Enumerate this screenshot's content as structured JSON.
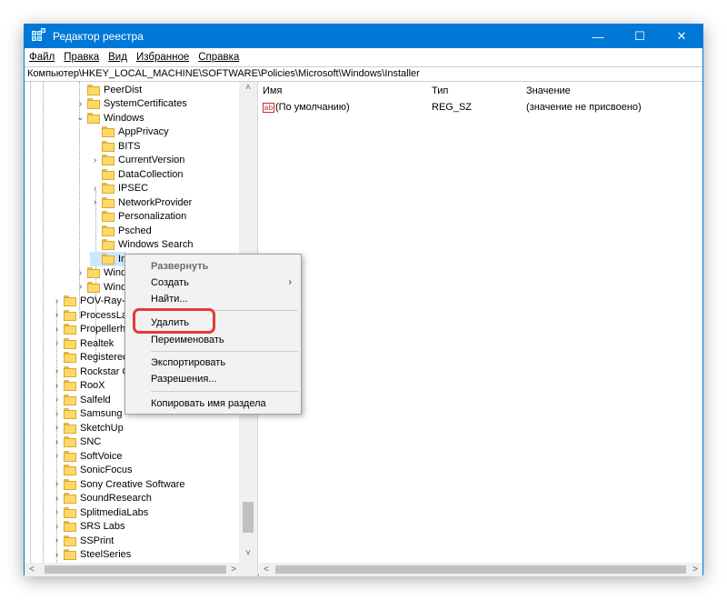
{
  "window": {
    "title": "Редактор реестра",
    "controls": [
      "—",
      "☐",
      "✕"
    ]
  },
  "menu": [
    "Файл",
    "Правка",
    "Вид",
    "Избранное",
    "Справка"
  ],
  "address": "Компьютер\\HKEY_LOCAL_MACHINE\\SOFTWARE\\Policies\\Microsoft\\Windows\\Installer",
  "tree": {
    "items": [
      {
        "label": "PeerDist",
        "exp": ""
      },
      {
        "label": "SystemCertificates",
        "exp": "›"
      },
      {
        "label": "Windows",
        "exp": "⌄"
      },
      {
        "label": "AppPrivacy",
        "exp": ""
      },
      {
        "label": "BITS",
        "exp": ""
      },
      {
        "label": "CurrentVersion",
        "exp": "›"
      },
      {
        "label": "DataCollection",
        "exp": ""
      },
      {
        "label": "IPSEC",
        "exp": "›"
      },
      {
        "label": "NetworkProvider",
        "exp": "›"
      },
      {
        "label": "Personalization",
        "exp": ""
      },
      {
        "label": "Psched",
        "exp": ""
      },
      {
        "label": "Windows Search",
        "exp": ""
      },
      {
        "label": "In",
        "exp": ""
      },
      {
        "label": "Wind",
        "exp": "›"
      },
      {
        "label": "Wind",
        "exp": "›"
      },
      {
        "label": "POV-Ray-F",
        "exp": "›"
      },
      {
        "label": "ProcessLass",
        "exp": "›"
      },
      {
        "label": "Propellerhe",
        "exp": "›"
      },
      {
        "label": "Realtek",
        "exp": "›"
      },
      {
        "label": "RegisteredA",
        "exp": ""
      },
      {
        "label": "Rockstar Ga",
        "exp": "›"
      },
      {
        "label": "RooX",
        "exp": "›"
      },
      {
        "label": "Salfeld",
        "exp": "›"
      },
      {
        "label": "Samsung",
        "exp": "›"
      },
      {
        "label": "SketchUp",
        "exp": "›"
      },
      {
        "label": "SNC",
        "exp": "›"
      },
      {
        "label": "SoftVoice",
        "exp": "›"
      },
      {
        "label": "SonicFocus",
        "exp": ""
      },
      {
        "label": "Sony Creative Software",
        "exp": "›"
      },
      {
        "label": "SoundResearch",
        "exp": "›"
      },
      {
        "label": "SplitmediaLabs",
        "exp": "›"
      },
      {
        "label": "SRS Labs",
        "exp": "›"
      },
      {
        "label": "SSPrint",
        "exp": "›"
      },
      {
        "label": "SteelSeries",
        "exp": "›"
      }
    ]
  },
  "list": {
    "columns": [
      "Имя",
      "Тип",
      "Значение"
    ],
    "rows": [
      {
        "icon": "ab",
        "name": "(По умолчанию)",
        "type": "REG_SZ",
        "value": "(значение не присвоено)"
      }
    ]
  },
  "context_menu": {
    "expand": "Развернуть",
    "create": "Создать",
    "find": "Найти...",
    "delete": "Удалить",
    "rename": "Переименовать",
    "export": "Экспортировать",
    "permissions": "Разрешения...",
    "copy_key": "Копировать имя раздела"
  },
  "scroll_arrows": {
    "up": "˄",
    "down": "˅",
    "left": "<",
    "right": ">"
  },
  "colors": {
    "titlebar": "#0078d7",
    "selection": "#cce8ff",
    "highlight": "#e53935"
  }
}
